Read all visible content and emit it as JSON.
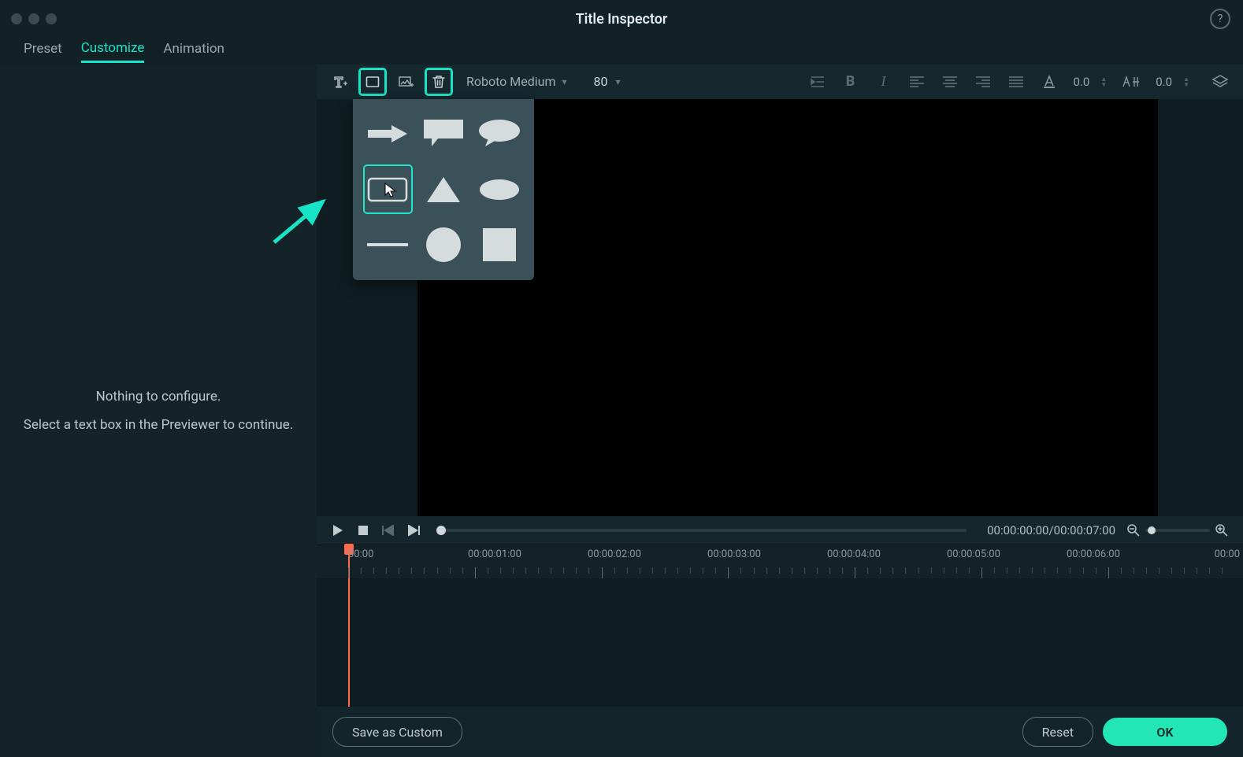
{
  "window": {
    "title": "Title Inspector"
  },
  "tabs": {
    "preset": "Preset",
    "customize": "Customize",
    "animation": "Animation",
    "active": "customize"
  },
  "sidebar": {
    "msg1": "Nothing to configure.",
    "msg2": "Select a text box in the Previewer to continue."
  },
  "toolbar": {
    "font": "Roboto Medium",
    "size": "80",
    "spacing1": "0.0",
    "spacing2": "0.0",
    "icons": {
      "addText": "add-text-icon",
      "addShape": "add-shape-icon",
      "addImage": "add-image-icon",
      "delete": "delete-icon",
      "indent": "indent-icon",
      "bold": "bold-icon",
      "italic": "italic-icon",
      "alignLeft": "align-left-icon",
      "alignCenter": "align-center-icon",
      "alignRight": "align-right-icon",
      "alignJustify": "align-justify-icon",
      "textColor": "text-color-icon",
      "tracking": "tracking-icon",
      "layers": "layers-icon"
    }
  },
  "shapes": {
    "selected": "rounded-rectangle",
    "items": [
      "arrow-right",
      "speech-rect",
      "speech-oval",
      "rounded-rectangle",
      "triangle",
      "ellipse",
      "line",
      "circle",
      "square"
    ]
  },
  "transport": {
    "timecode": "00:00:00:00/00:00:07:00"
  },
  "ruler": {
    "labels": [
      "00:00",
      "00:00:01:00",
      "00:00:02:00",
      "00:00:03:00",
      "00:00:04:00",
      "00:00:05:00",
      "00:00:06:00",
      "00:00"
    ]
  },
  "footer": {
    "save": "Save as Custom",
    "reset": "Reset",
    "ok": "OK"
  }
}
